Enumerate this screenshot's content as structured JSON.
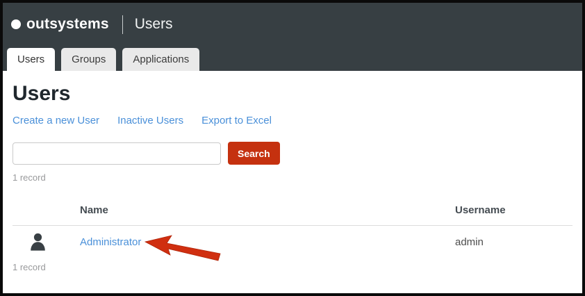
{
  "header": {
    "brand": "outsystems",
    "app_title": "Users"
  },
  "tabs": [
    {
      "label": "Users",
      "active": true
    },
    {
      "label": "Groups",
      "active": false
    },
    {
      "label": "Applications",
      "active": false
    }
  ],
  "page": {
    "title": "Users"
  },
  "toolbar": {
    "links": [
      {
        "label": "Create a new User"
      },
      {
        "label": "Inactive Users"
      },
      {
        "label": "Export to Excel"
      }
    ]
  },
  "search": {
    "value": "",
    "placeholder": "",
    "button_label": "Search"
  },
  "counts": {
    "top": "1 record",
    "bottom": "1 record"
  },
  "table": {
    "columns": [
      {
        "label": "Name"
      },
      {
        "label": "Username"
      }
    ],
    "rows": [
      {
        "name": "Administrator",
        "username": "admin",
        "icon": "user-silhouette-icon"
      }
    ]
  },
  "annotations": {
    "arrow": {
      "shape": "arrow-pointing-left",
      "target": "Administrator",
      "color": "#d02f10"
    }
  },
  "colors": {
    "header_bg": "#373f43",
    "tab_inactive_bg": "#e9e9e9",
    "link_blue": "#4a90d9",
    "button_red": "#c5310f",
    "arrow_red": "#d02f10",
    "border_black": "#0a0a0a",
    "divider_gray": "#dcdcdc"
  }
}
